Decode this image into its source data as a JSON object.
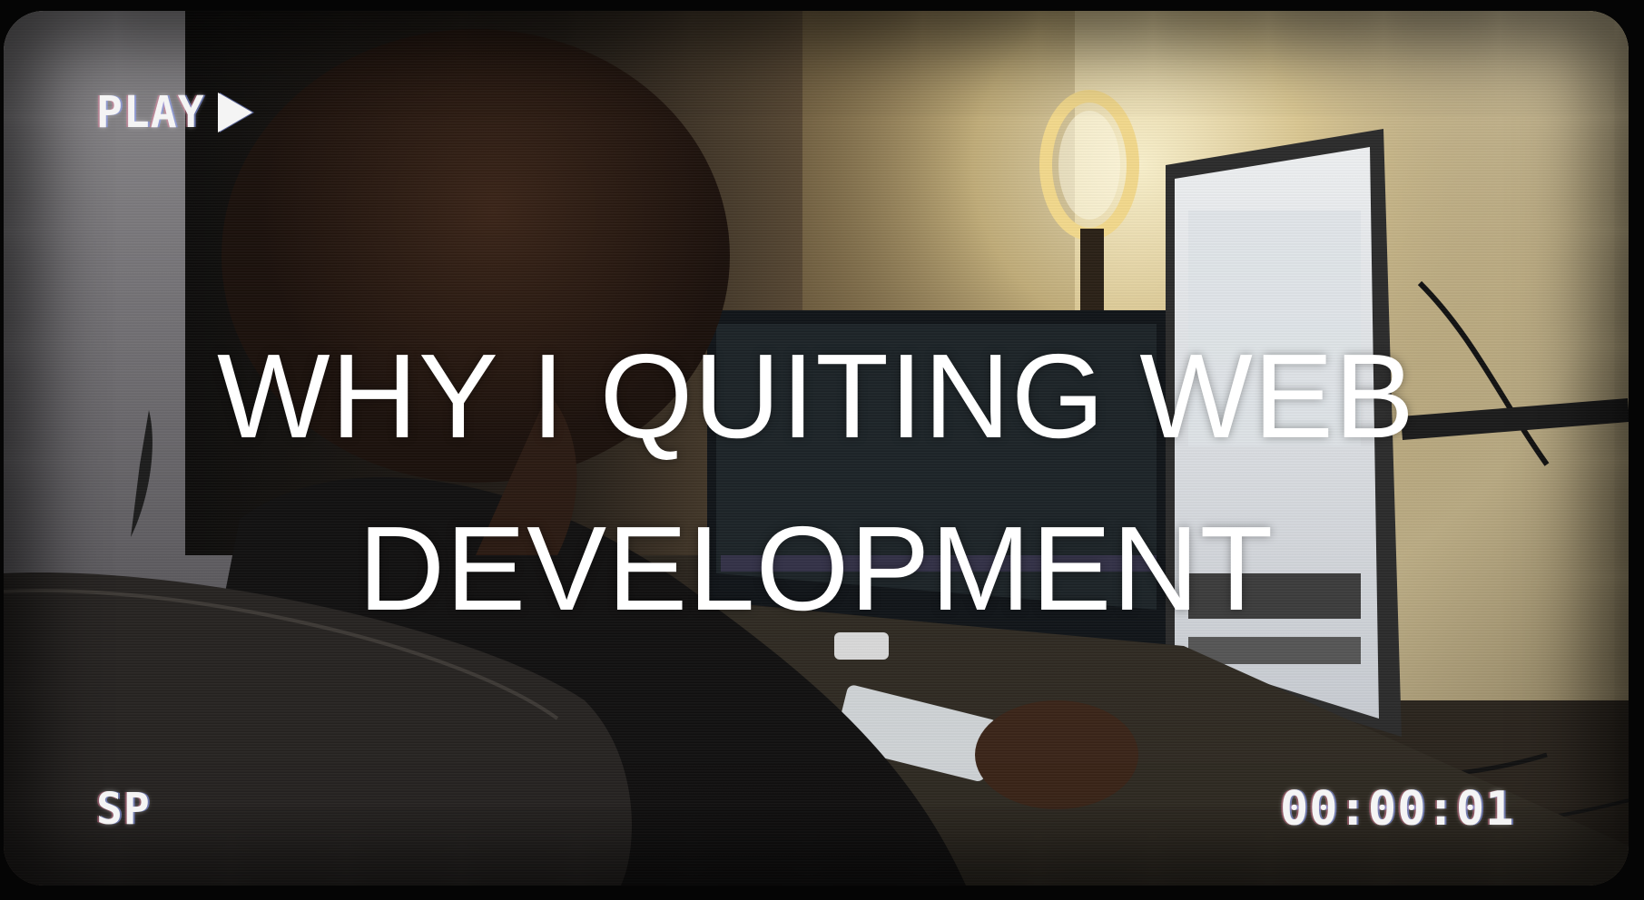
{
  "osd": {
    "play_label": "PLAY",
    "play_icon": "play-triangle-icon",
    "mode_label": "SP",
    "counter": "00:00:01"
  },
  "title": {
    "line1": "WHY I QUITING WEB",
    "line2": "DEVELOPMENT"
  }
}
